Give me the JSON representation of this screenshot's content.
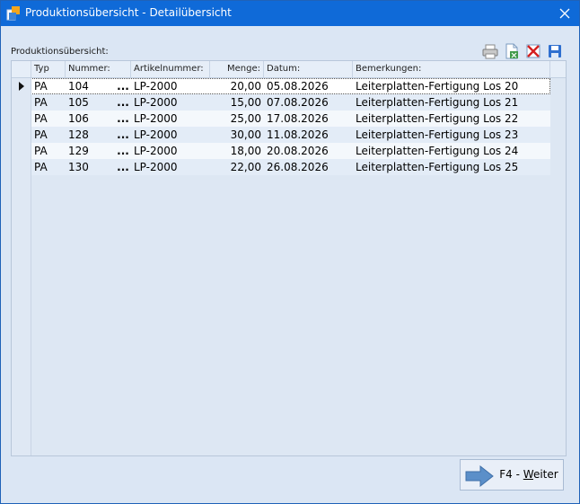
{
  "window": {
    "title": "Produktionsübersicht - Detailübersicht"
  },
  "section": {
    "label": "Produktionsübersicht:"
  },
  "toolbar": {
    "buttons": [
      {
        "icon": "printer-icon"
      },
      {
        "icon": "export-document-icon"
      },
      {
        "icon": "delete-icon"
      },
      {
        "icon": "save-icon"
      }
    ]
  },
  "grid": {
    "columns": [
      "Typ",
      "Nummer:",
      "Artikelnummer:",
      "Menge:",
      "Datum:",
      "Bemerkungen:"
    ],
    "rows": [
      {
        "typ": "PA",
        "nummer": "104",
        "lookup": "...",
        "artikel": "LP-2000",
        "menge": "20,00",
        "datum": "05.08.2026",
        "bemerkung": "Leiterplatten-Fertigung Los 20"
      },
      {
        "typ": "PA",
        "nummer": "105",
        "lookup": "...",
        "artikel": "LP-2000",
        "menge": "15,00",
        "datum": "07.08.2026",
        "bemerkung": "Leiterplatten-Fertigung Los 21"
      },
      {
        "typ": "PA",
        "nummer": "106",
        "lookup": "...",
        "artikel": "LP-2000",
        "menge": "25,00",
        "datum": "17.08.2026",
        "bemerkung": "Leiterplatten-Fertigung Los 22"
      },
      {
        "typ": "PA",
        "nummer": "128",
        "lookup": "...",
        "artikel": "LP-2000",
        "menge": "30,00",
        "datum": "11.08.2026",
        "bemerkung": "Leiterplatten-Fertigung Los 23"
      },
      {
        "typ": "PA",
        "nummer": "129",
        "lookup": "...",
        "artikel": "LP-2000",
        "menge": "18,00",
        "datum": "20.08.2026",
        "bemerkung": "Leiterplatten-Fertigung Los 24"
      },
      {
        "typ": "PA",
        "nummer": "130",
        "lookup": "...",
        "artikel": "LP-2000",
        "menge": "22,00",
        "datum": "26.08.2026",
        "bemerkung": "Leiterplatten-Fertigung Los 25"
      }
    ]
  },
  "footer": {
    "next_button": {
      "shortcut": "F4 - ",
      "mnemonic": "W",
      "rest": "eiter"
    }
  },
  "colors": {
    "titlebar": "#0f6ad8",
    "background": "#dbe6f4",
    "arrow": "#5b8fc9"
  }
}
